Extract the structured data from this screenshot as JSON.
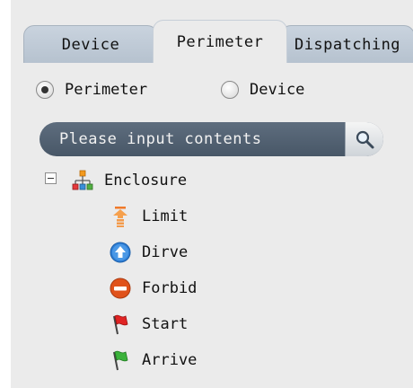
{
  "tabs": [
    {
      "label": "Device",
      "active": false
    },
    {
      "label": "Perimeter",
      "active": true
    },
    {
      "label": "Dispatching",
      "active": false
    }
  ],
  "radios": {
    "perimeter": {
      "label": "Perimeter",
      "selected": true
    },
    "device": {
      "label": "Device",
      "selected": false
    }
  },
  "search": {
    "placeholder": "Please input contents",
    "icon": "search-icon"
  },
  "tree": {
    "root": {
      "label": "Enclosure",
      "icon": "enclosure-network-icon",
      "expanded": true
    },
    "children": [
      {
        "label": "Limit",
        "icon": "limit-icon"
      },
      {
        "label": "Dirve",
        "icon": "drive-icon"
      },
      {
        "label": "Forbid",
        "icon": "forbid-icon"
      },
      {
        "label": "Start",
        "icon": "start-flag-icon"
      },
      {
        "label": "Arrive",
        "icon": "arrive-flag-icon"
      }
    ]
  },
  "colors": {
    "panel": "#ebebeb",
    "tab_inactive": "#c0cad5",
    "search_bar": "#526171"
  }
}
